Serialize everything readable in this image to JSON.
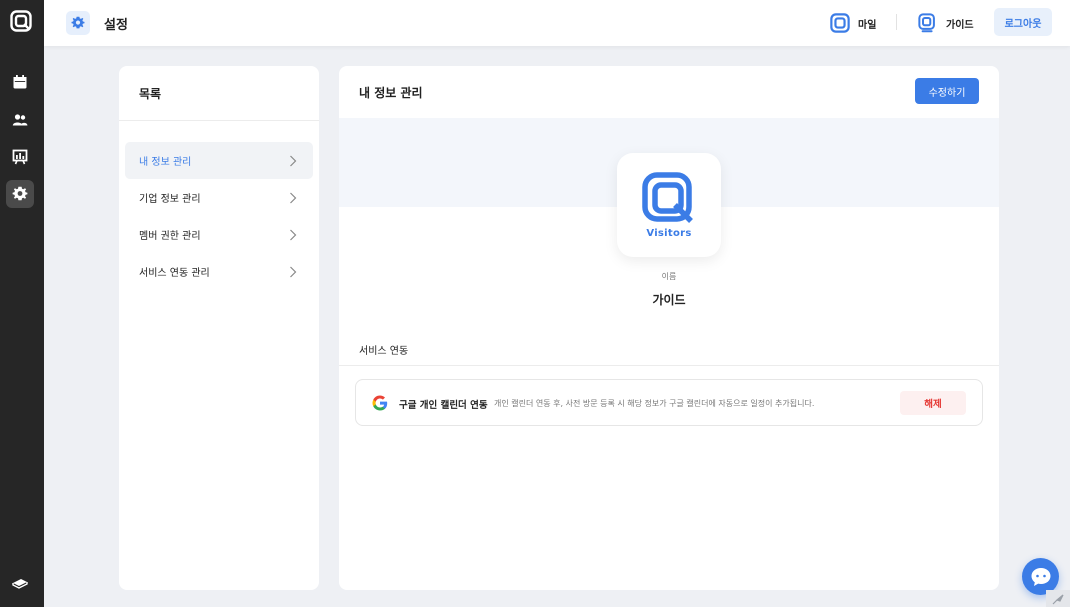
{
  "topbar": {
    "title": "설정",
    "workspace_label": "마일",
    "guide_label": "가이드",
    "logout_label": "로그아웃"
  },
  "rail": {
    "items": [
      "calendar-icon",
      "users-icon",
      "chart-board-icon",
      "gear-icon"
    ],
    "bottom": "book-icon"
  },
  "menu": {
    "heading": "목록",
    "items": [
      {
        "label": "내 정보 관리",
        "active": true
      },
      {
        "label": "기업 정보 관리",
        "active": false
      },
      {
        "label": "멤버 권한 관리",
        "active": false
      },
      {
        "label": "서비스 연동 관리",
        "active": false
      }
    ]
  },
  "content": {
    "heading": "내 정보 관리",
    "edit_label": "수정하기",
    "avatar_brand": "Visitors",
    "name_label": "이름",
    "name_value": "가이드",
    "services_title": "서비스 연동",
    "service": {
      "name": "구글 개인 캘린더 연동",
      "description": "개인 캘린더 연동 후, 사전 방문 등록 시 해당 정보가 구글 캘린더에 자동으로 일정이 추가됩니다.",
      "action_label": "해제"
    }
  },
  "colors": {
    "accent": "#3b7ce6",
    "rail": "#262626",
    "danger": "#e53935"
  }
}
